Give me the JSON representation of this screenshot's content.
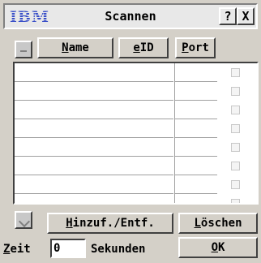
{
  "window": {
    "logo": "IBM",
    "title": "Scannen",
    "help_glyph": "?",
    "close_glyph": "X"
  },
  "columns": {
    "name_rest": "ame",
    "name_key": "N",
    "eid_key": "e",
    "eid_rest": "ID",
    "port_key": "P",
    "port_rest": "ort"
  },
  "rows": [
    {
      "name": "",
      "eid": "",
      "port": "",
      "checked": false
    },
    {
      "name": "",
      "eid": "",
      "port": "",
      "checked": false
    },
    {
      "name": "",
      "eid": "",
      "port": "",
      "checked": false
    },
    {
      "name": "",
      "eid": "",
      "port": "",
      "checked": false
    },
    {
      "name": "",
      "eid": "",
      "port": "",
      "checked": false
    },
    {
      "name": "",
      "eid": "",
      "port": "",
      "checked": false
    },
    {
      "name": "",
      "eid": "",
      "port": "",
      "checked": false
    },
    {
      "name": "",
      "eid": "",
      "port": "",
      "checked": false
    }
  ],
  "buttons": {
    "hinzuf_key": "H",
    "hinzuf_rest": "inzuf./Entf.",
    "loeschen_key": "L",
    "loeschen_rest": "öschen",
    "ok_key": "O",
    "ok_rest": "K"
  },
  "scan": {
    "zeit_key": "Z",
    "zeit_rest": "eit",
    "value": "0",
    "unit": "Sekunden"
  },
  "colors": {
    "logo": "#3a4fc8",
    "face": "#d4d0c8"
  }
}
